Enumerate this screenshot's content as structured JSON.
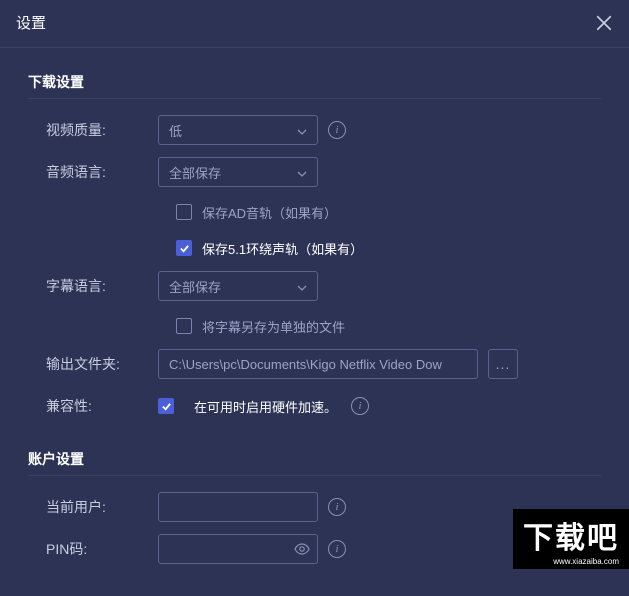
{
  "header": {
    "title": "设置"
  },
  "sections": {
    "download": "下载设置",
    "account": "账户设置"
  },
  "videoQuality": {
    "label": "视频质量:",
    "value": "低"
  },
  "audioLanguage": {
    "label": "音频语言:",
    "value": "全部保存"
  },
  "checkboxes": {
    "saveAD": {
      "label": "保存AD音轨（如果有）",
      "checked": false
    },
    "save51": {
      "label": "保存5.1环绕声轨（如果有）",
      "checked": true
    },
    "subtitleSeparate": {
      "label": "将字幕另存为单独的文件",
      "checked": false
    },
    "hardwareAccel": {
      "label": "在可用时启用硬件加速。",
      "checked": true
    }
  },
  "subtitleLanguage": {
    "label": "字幕语言:",
    "value": "全部保存"
  },
  "outputFolder": {
    "label": "输出文件夹:",
    "value": "C:\\Users\\pc\\Documents\\Kigo Netflix Video Dow",
    "browse": "..."
  },
  "compatibility": {
    "label": "兼容性:"
  },
  "currentUser": {
    "label": "当前用户:",
    "value": ""
  },
  "pinCode": {
    "label": "PIN码:",
    "value": ""
  },
  "watermark": {
    "main": "下载吧",
    "sub": "www.xiazaiba.com"
  }
}
